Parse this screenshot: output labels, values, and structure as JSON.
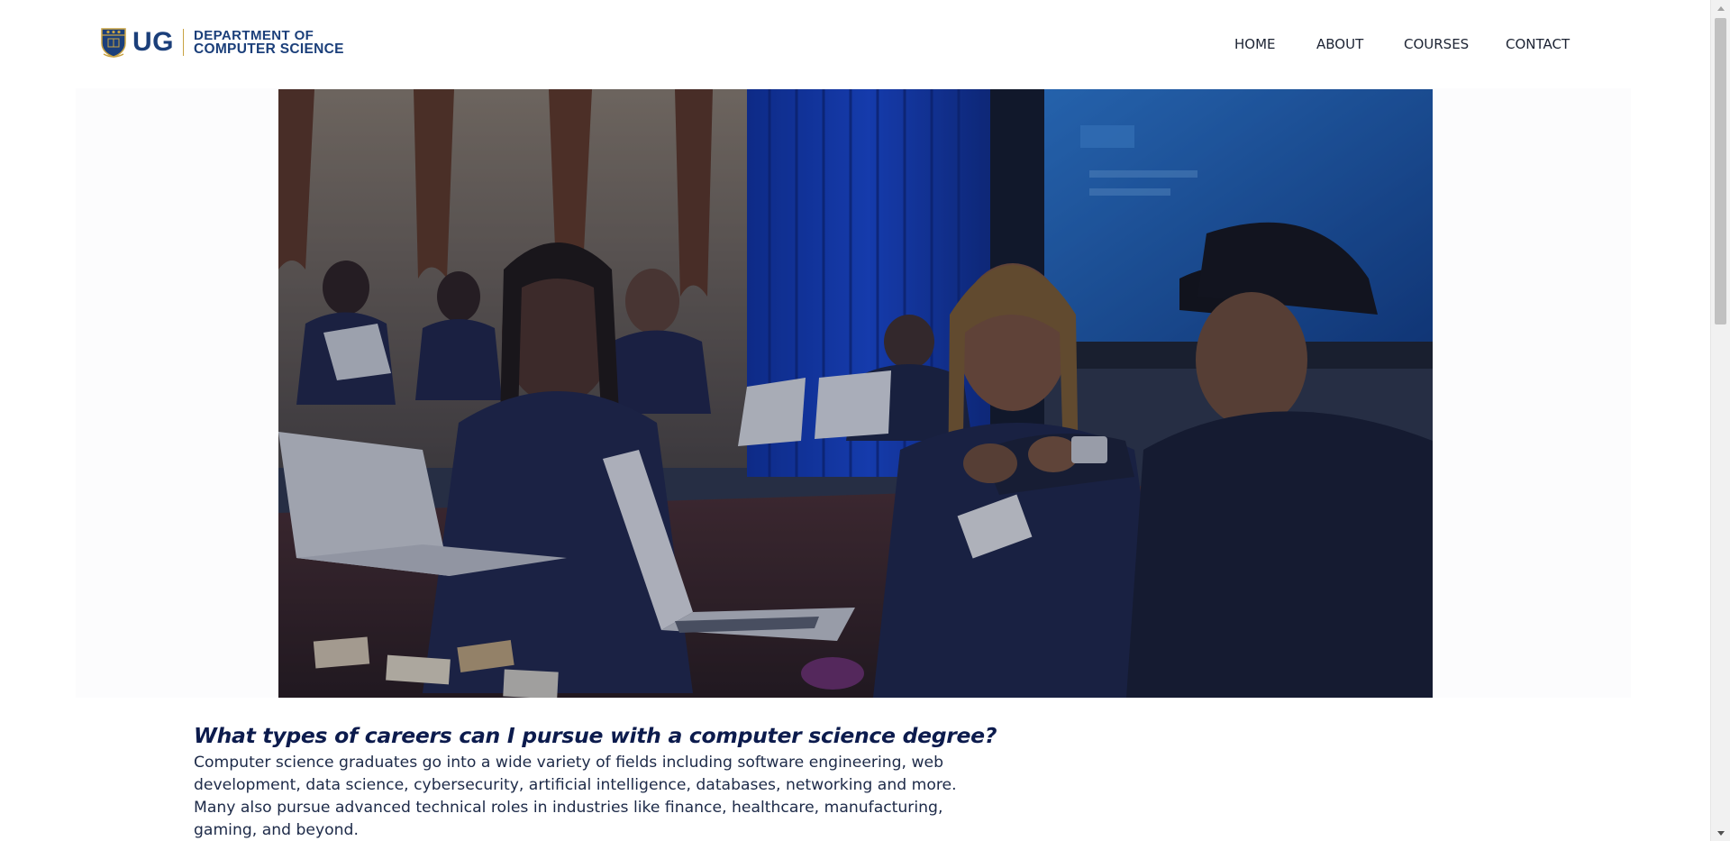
{
  "header": {
    "logo": {
      "short": "UG",
      "line1": "DEPARTMENT OF",
      "line2": "COMPUTER SCIENCE"
    },
    "nav": [
      {
        "label": "HOME"
      },
      {
        "label": "ABOUT"
      },
      {
        "label": "COURSES"
      },
      {
        "label": "CONTACT"
      }
    ]
  },
  "hero": {
    "image_subject": "students-with-laptops-photo",
    "overlay_color": "#1a2038"
  },
  "content": {
    "question": "What types of careers can I pursue with a computer science degree?",
    "answer": "Computer science graduates go into a wide variety of fields including software engineering, web development, data science, cybersecurity, artificial intelligence, databases, networking and more. Many also pursue advanced technical roles in industries like finance, healthcare, manufacturing, gaming, and beyond."
  },
  "icons": {
    "crest": "shield-crest-icon",
    "scroll_up": "chevron-up-icon",
    "scroll_down": "chevron-down-icon"
  },
  "colors": {
    "brand_blue": "#1b3f7a",
    "heading_navy": "#0c1b4d",
    "body_text": "#1d2a48",
    "gold": "#c9a343"
  }
}
